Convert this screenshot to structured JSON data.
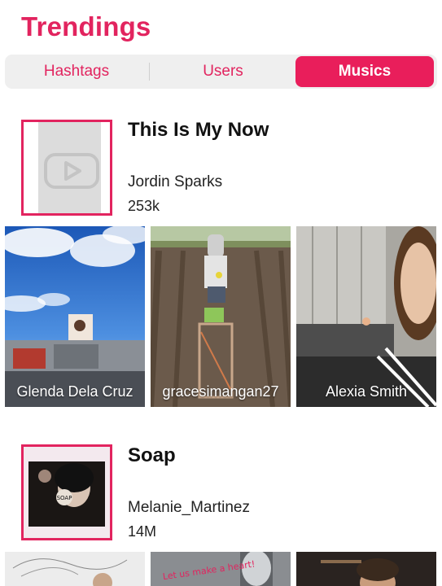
{
  "header": {
    "title": "Trendings"
  },
  "tabs": [
    {
      "label": "Hashtags",
      "active": false
    },
    {
      "label": "Users",
      "active": false
    },
    {
      "label": "Musics",
      "active": true
    }
  ],
  "colors": {
    "accent": "#e2245f",
    "tab_active_bg": "#e91e5b",
    "tabs_bg": "#efefef"
  },
  "musics": [
    {
      "title": "This Is My Now",
      "artist": "Jordin Sparks",
      "count": "253k",
      "cover_icon": "youtube-play-icon",
      "videos": [
        {
          "user": "Glenda Dela Cruz"
        },
        {
          "user": "gracesimangan27"
        },
        {
          "user": "Alexia Smith"
        }
      ]
    },
    {
      "title": "Soap",
      "artist": "Melanie_Martinez",
      "count": "14M",
      "cover_sticker_text": "SOAP",
      "videos_overlay_text": "Let us make a heart!"
    }
  ]
}
